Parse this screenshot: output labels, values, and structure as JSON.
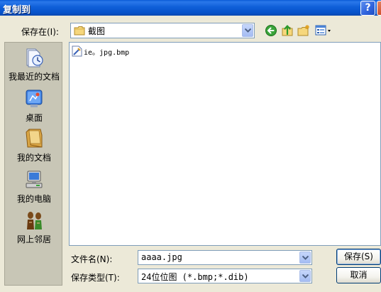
{
  "window": {
    "title": "复制到",
    "help_label": "?"
  },
  "save_in": {
    "label": "保存在(I):",
    "value": "截图"
  },
  "toolbar": {
    "icons": [
      "back-icon",
      "up-folder-icon",
      "new-folder-icon",
      "view-menu-icon"
    ]
  },
  "places": [
    {
      "label": "我最近的文档",
      "icon": "recent-documents-icon"
    },
    {
      "label": "桌面",
      "icon": "desktop-icon"
    },
    {
      "label": "我的文档",
      "icon": "my-documents-icon"
    },
    {
      "label": "我的电脑",
      "icon": "my-computer-icon"
    },
    {
      "label": "网上邻居",
      "icon": "network-places-icon"
    }
  ],
  "files": [
    {
      "name": "ie。jpg.bmp",
      "icon": "bitmap-file-icon"
    }
  ],
  "file_name": {
    "label": "文件名(N):",
    "value": "aaaa.jpg"
  },
  "save_type": {
    "label": "保存类型(T):",
    "value": "24位位图 (*.bmp;*.dib)"
  },
  "buttons": {
    "save": "保存(S)",
    "cancel": "取消"
  },
  "colors": {
    "titlebar": "#0a5ad6",
    "dialog_bg": "#ece9d8",
    "places_bg": "#c8c6b6"
  }
}
